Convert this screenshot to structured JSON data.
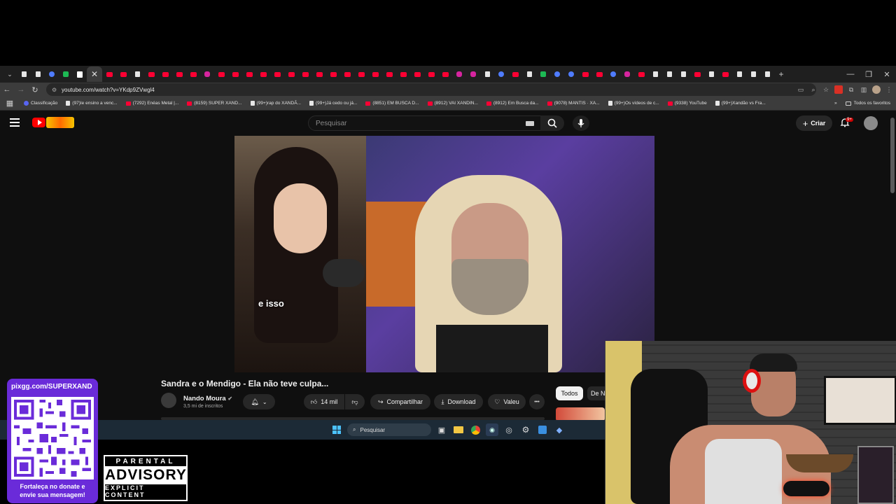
{
  "browser": {
    "url": "youtube.com/watch?v=YKdp9ZVwgl4",
    "tabs": [
      "tk",
      "tk",
      "bl",
      "gr",
      "wt",
      "active",
      "yt",
      "yt",
      "tk",
      "yt",
      "yt",
      "yt",
      "yt",
      "ig",
      "yt",
      "yt",
      "yt",
      "yt",
      "yt",
      "yt",
      "yt",
      "yt",
      "yt",
      "yt",
      "yt",
      "yt",
      "yt",
      "yt",
      "yt",
      "yt",
      "yt",
      "ig",
      "ig",
      "tk",
      "bl",
      "yt",
      "tk",
      "gr",
      "bl",
      "bl",
      "yt",
      "yt",
      "bl",
      "ig",
      "yt",
      "tk",
      "tk",
      "tk",
      "yt",
      "tk",
      "yt",
      "tk",
      "tk",
      "tk"
    ],
    "active_tab_close": "✕",
    "new_tab": "+",
    "bookmarks": [
      {
        "label": "Classificação",
        "icon": "dc"
      },
      {
        "label": "(97)Ie ensino a venc...",
        "icon": "tk"
      },
      {
        "label": "(7292) Enéas Metal |...",
        "icon": "yt"
      },
      {
        "label": "(8159) SUPER XAND...",
        "icon": "yt"
      },
      {
        "label": "(99+)rap do XANDÃ...",
        "icon": "tk"
      },
      {
        "label": "(99+)Já cedo ou já...",
        "icon": "tk"
      },
      {
        "label": "(8851) EM BUSCA D...",
        "icon": "yt"
      },
      {
        "label": "(8912) VAI XANDIN...",
        "icon": "yt"
      },
      {
        "label": "(8912) Em Busca da...",
        "icon": "yt"
      },
      {
        "label": "(9078) MANTIS · XA...",
        "icon": "yt"
      },
      {
        "label": "(99+)Os vídeos de c...",
        "icon": "tk"
      },
      {
        "label": "(9338) YouTube",
        "icon": "yt"
      },
      {
        "label": "(99+)Xandão vs Fra...",
        "icon": "tk"
      }
    ],
    "all_bookmarks": "Todos os favoritos"
  },
  "youtube": {
    "search_placeholder": "Pesquisar",
    "create_label": "Criar",
    "notif_badge": "9+",
    "caption": "e isso",
    "video_title": "Sandra e o Mendigo - Ela não teve culpa...",
    "channel_name": "Nando Moura",
    "subscribers": "3,5 mi de inscritos",
    "likes": "14 mil",
    "share_label": "Compartilhar",
    "download_label": "Download",
    "thanks_label": "Valeu",
    "more_label": "•••",
    "chip_all": "Todos",
    "chip_next": "De Na"
  },
  "taskbar": {
    "search_placeholder": "Pesquisar"
  },
  "overlay": {
    "qr_url": "pixgg.com/SUPERXAND",
    "qr_line1": "Fortaleça no donate e",
    "qr_line2": "envie sua mensagem!",
    "advisory_top": "PARENTAL",
    "advisory_mid": "ADVISORY",
    "advisory_bot": "EXPLICIT CONTENT"
  },
  "colors": {
    "youtube_red": "#ff0000",
    "qr_purple": "#6a2bd9",
    "taskbar": "#1c2a36"
  }
}
